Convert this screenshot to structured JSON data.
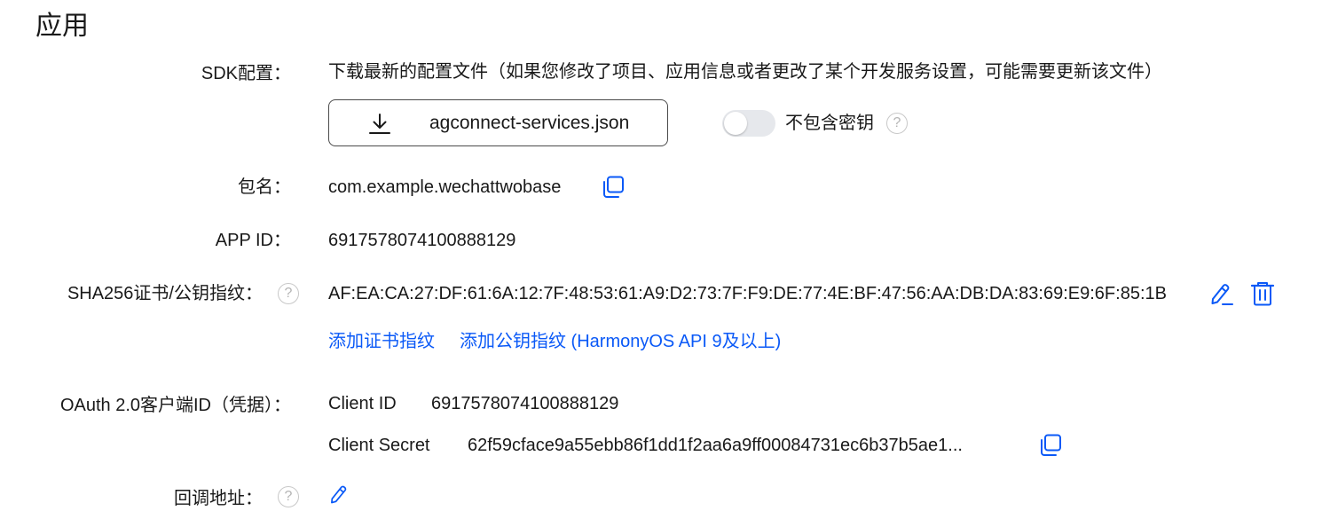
{
  "section": {
    "title": "应用"
  },
  "sdk": {
    "label": "SDK配置：",
    "description": "下载最新的配置文件（如果您修改了项目、应用信息或者更改了某个开发服务设置，可能需要更新该文件）",
    "download_label": "agconnect-services.json",
    "exclude_key_label": "不包含密钥",
    "exclude_key_enabled": false
  },
  "package": {
    "label": "包名：",
    "value": "com.example.wechattwobase"
  },
  "app_id": {
    "label": "APP ID：",
    "value": "6917578074100888129"
  },
  "sha256": {
    "label": "SHA256证书/公钥指纹：",
    "value": "AF:EA:CA:27:DF:61:6A:12:7F:48:53:61:A9:D2:73:7F:F9:DE:77:4E:BF:47:56:AA:DB:DA:83:69:E9:6F:85:1B",
    "add_cert_link": "添加证书指纹",
    "add_pubkey_link": "添加公钥指纹 (HarmonyOS API 9及以上)"
  },
  "oauth": {
    "label": "OAuth 2.0客户端ID（凭据）：",
    "client_id_label": "Client ID",
    "client_id_value": "6917578074100888129",
    "client_secret_label": "Client Secret",
    "client_secret_value": "62f59cface9a55ebb86f1dd1f2aa6a9ff00084731ec6b37b5ae1..."
  },
  "callback": {
    "label": "回调地址："
  },
  "icons": {
    "help": "?",
    "download": "download-icon",
    "copy": "copy-icon",
    "edit": "edit-icon",
    "delete": "trash-icon"
  },
  "colors": {
    "link": "#0a59f7",
    "icon_blue": "#0a59f7",
    "text": "#191919",
    "toggle_off": "#e6e8ec"
  }
}
